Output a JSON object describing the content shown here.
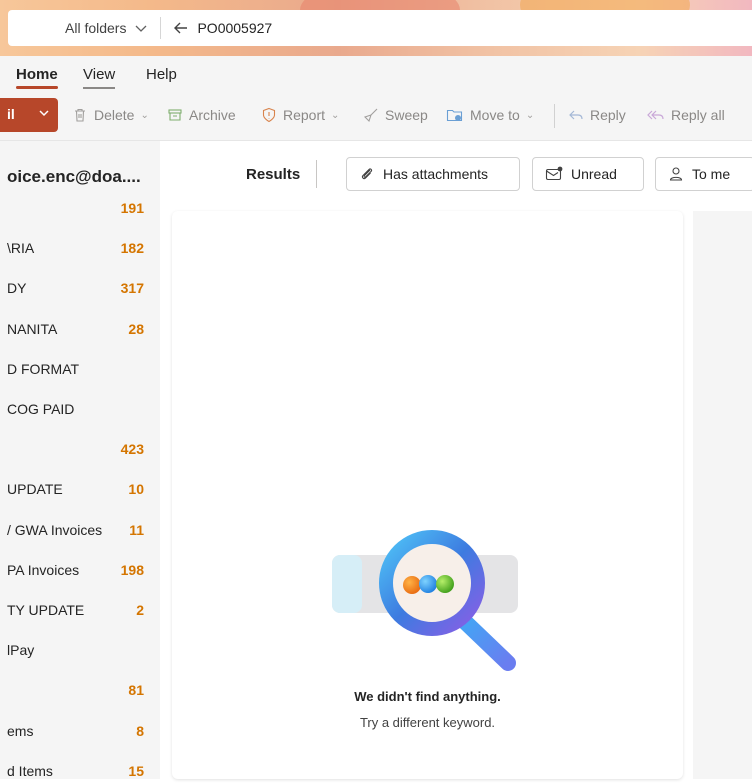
{
  "search": {
    "scope_label": "All folders",
    "query": "PO0005927"
  },
  "ribbon": {
    "tabs": [
      "Home",
      "View",
      "Help"
    ]
  },
  "toolbar": {
    "new_label": "il",
    "delete_label": "Delete",
    "archive_label": "Archive",
    "report_label": "Report",
    "sweep_label": "Sweep",
    "moveto_label": "Move to",
    "reply_label": "Reply",
    "replyall_label": "Reply all"
  },
  "sidebar": {
    "account": "oice.enc@doa....",
    "folders": [
      {
        "name": "",
        "count": "191"
      },
      {
        "name": "\\RIA",
        "count": "182"
      },
      {
        "name": "DY",
        "count": "317"
      },
      {
        "name": "NANITA",
        "count": "28"
      },
      {
        "name": "D FORMAT",
        "count": ""
      },
      {
        "name": "COG PAID",
        "count": ""
      },
      {
        "name": "",
        "count": "423"
      },
      {
        "name": "UPDATE",
        "count": "10"
      },
      {
        "name": "/ GWA Invoices",
        "count": "11"
      },
      {
        "name": "PA Invoices",
        "count": "198"
      },
      {
        "name": "TY UPDATE",
        "count": "2"
      },
      {
        "name": "lPay",
        "count": ""
      },
      {
        "name": "",
        "count": "81"
      },
      {
        "name": "ems",
        "count": "8"
      },
      {
        "name": "d Items",
        "count": "15"
      }
    ]
  },
  "filters": {
    "results_label": "Results",
    "has_attachments": "Has attachments",
    "unread": "Unread",
    "to_me": "To me"
  },
  "empty_state": {
    "title": "We didn't find anything.",
    "subtitle": "Try a different keyword."
  },
  "colors": {
    "accent": "#b7472a",
    "count": "#d47500",
    "pane_bg": "#f5f5f5"
  }
}
